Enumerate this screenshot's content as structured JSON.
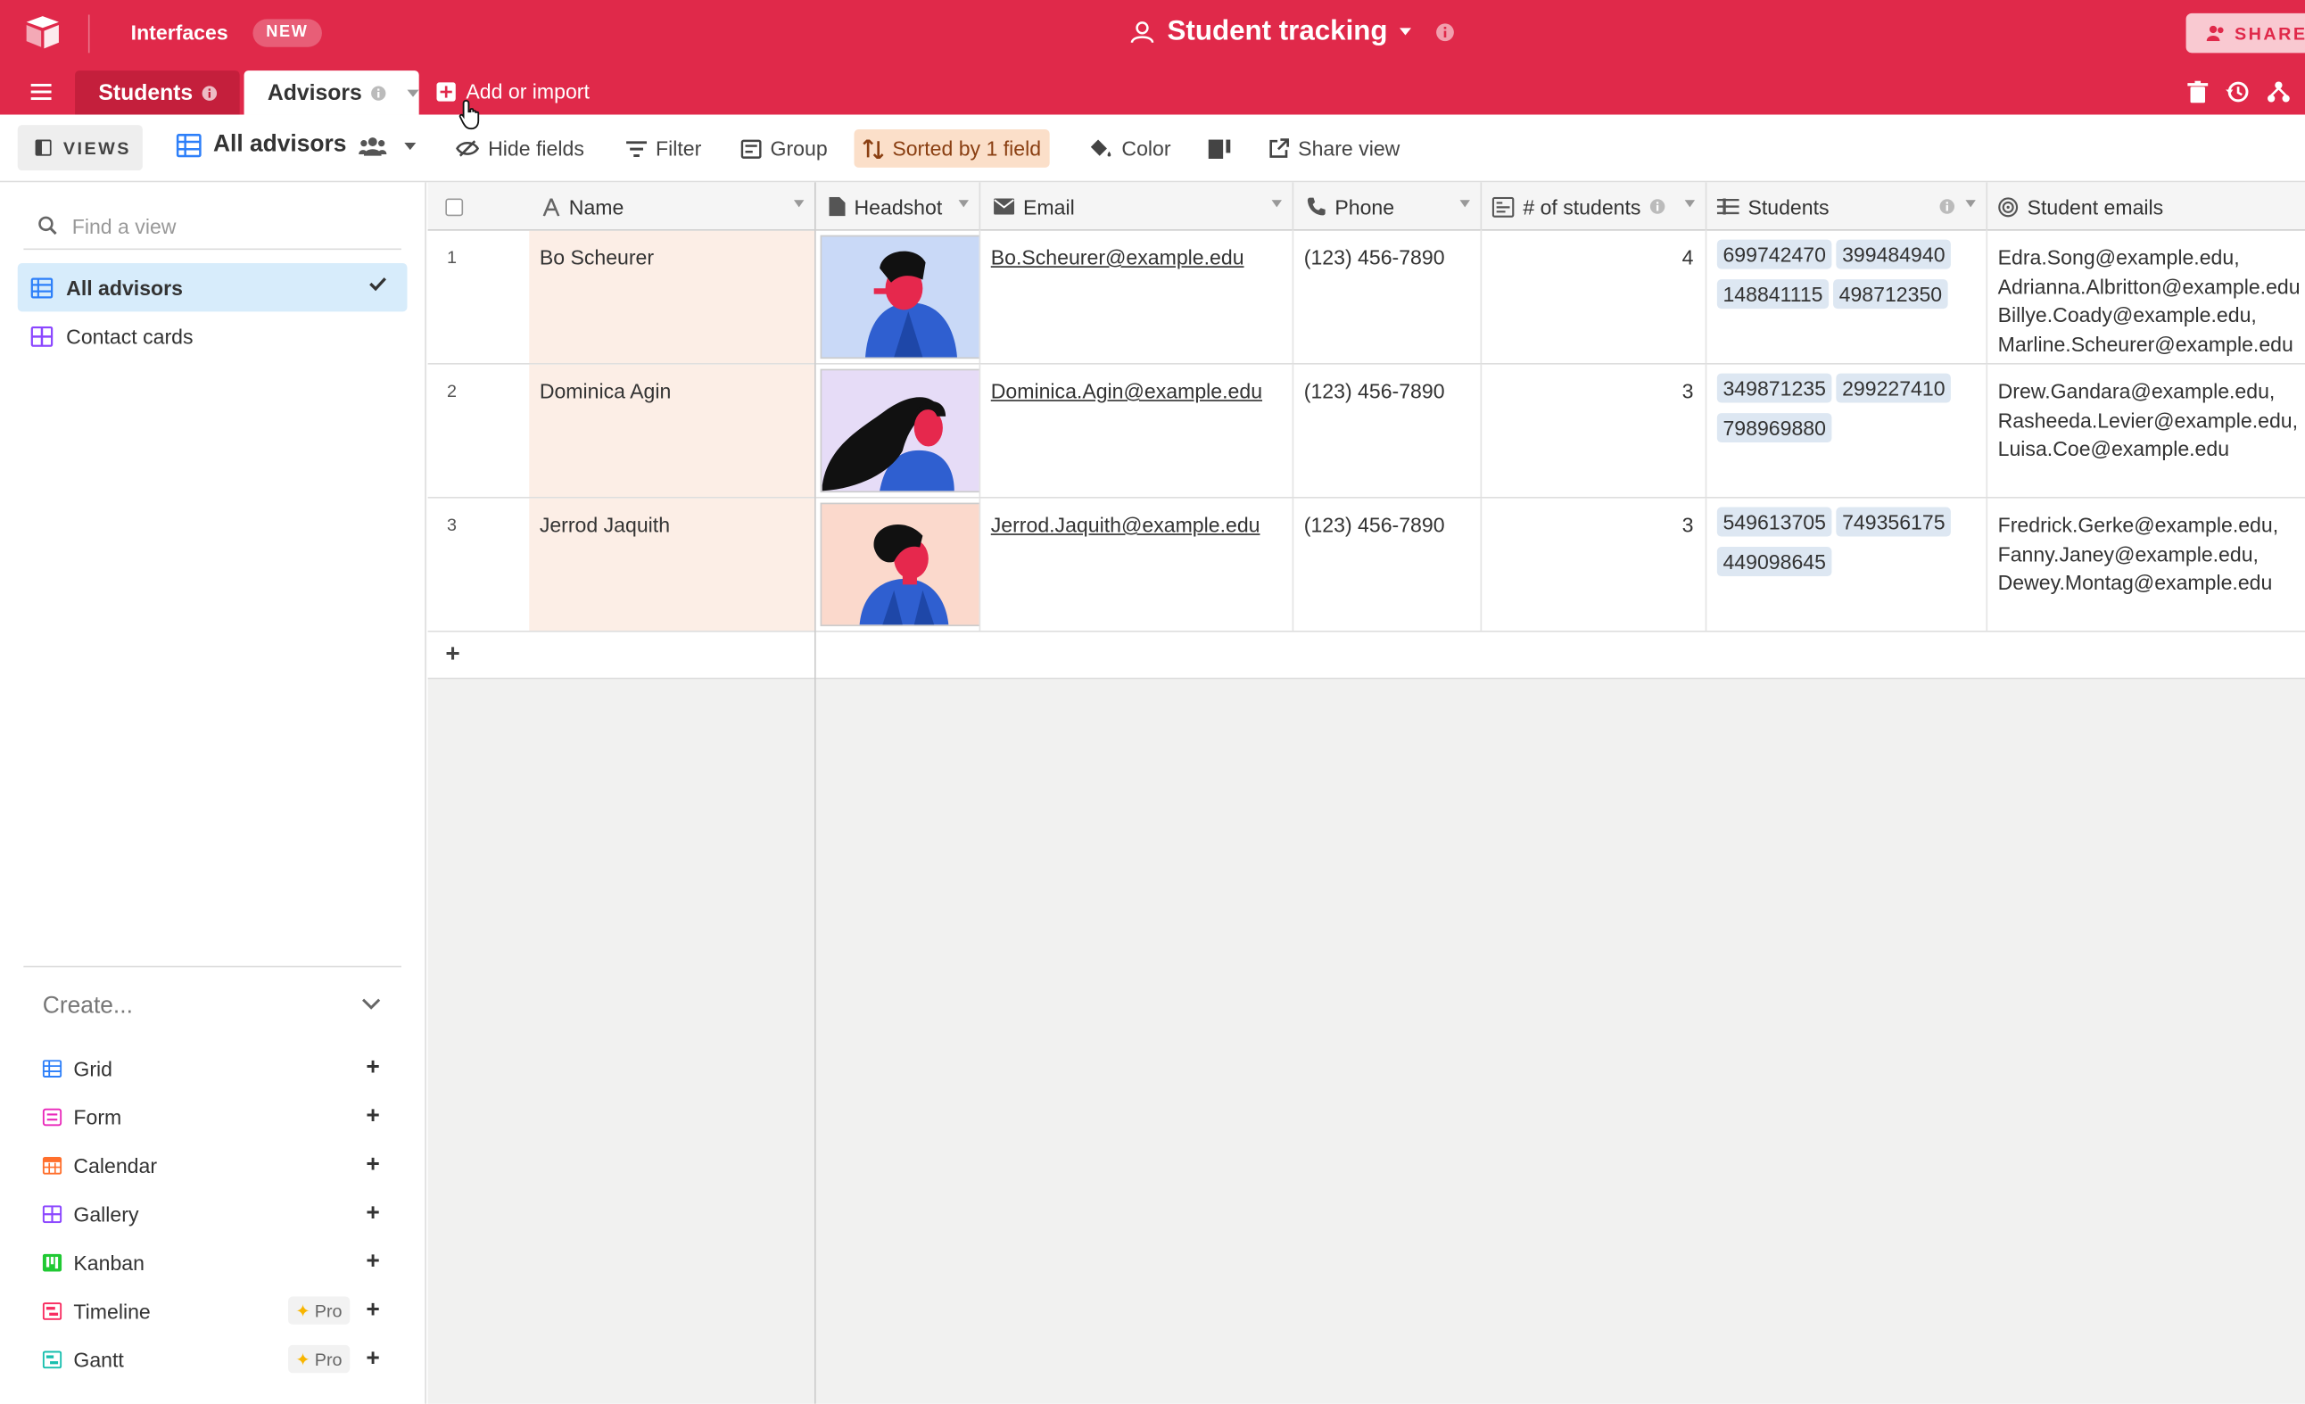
{
  "app": {
    "interfaces_label": "Interfaces",
    "new_badge": "NEW",
    "base_title": "Student tracking",
    "share_label": "SHARE"
  },
  "tabs": [
    {
      "label": "Students",
      "active": false
    },
    {
      "label": "Advisors",
      "active": true
    }
  ],
  "add_import_label": "Add or import",
  "toolbar": {
    "views_label": "VIEWS",
    "view_name": "All advisors",
    "hide_fields": "Hide fields",
    "filter": "Filter",
    "group": "Group",
    "sorted": "Sorted by 1 field",
    "color": "Color",
    "share_view": "Share view"
  },
  "sidebar": {
    "find_placeholder": "Find a view",
    "views": [
      {
        "label": "All advisors",
        "active": true
      },
      {
        "label": "Contact cards",
        "active": false
      }
    ],
    "create_label": "Create...",
    "create_items": [
      {
        "label": "Grid",
        "color": "#2d7ff9"
      },
      {
        "label": "Form",
        "color": "#e929ba"
      },
      {
        "label": "Calendar",
        "color": "#ff6f2c"
      },
      {
        "label": "Gallery",
        "color": "#8b46ff"
      },
      {
        "label": "Kanban",
        "color": "#20c933"
      },
      {
        "label": "Timeline",
        "color": "#f82b60",
        "pro": "Pro"
      },
      {
        "label": "Gantt",
        "color": "#18bfae",
        "pro": "Pro"
      }
    ]
  },
  "columns": {
    "name": "Name",
    "headshot": "Headshot",
    "email": "Email",
    "phone": "Phone",
    "num_students": "# of students",
    "students": "Students",
    "student_emails": "Student emails"
  },
  "rows": [
    {
      "num": "1",
      "name": "Bo Scheurer",
      "email": "Bo.Scheurer@example.edu",
      "phone": "(123) 456-7890",
      "count": "4",
      "students": [
        "699742470",
        "399484940",
        "148841115",
        "498712350"
      ],
      "student_emails": [
        "Edra.Song@example.edu,",
        "Adrianna.Albritton@example.edu",
        "Billye.Coady@example.edu,",
        "Marline.Scheurer@example.edu"
      ]
    },
    {
      "num": "2",
      "name": "Dominica Agin",
      "email": "Dominica.Agin@example.edu",
      "phone": "(123) 456-7890",
      "count": "3",
      "students": [
        "349871235",
        "299227410",
        "798969880"
      ],
      "student_emails": [
        "Drew.Gandara@example.edu,",
        "Rasheeda.Levier@example.edu,",
        "Luisa.Coe@example.edu"
      ]
    },
    {
      "num": "3",
      "name": "Jerrod Jaquith",
      "email": "Jerrod.Jaquith@example.edu",
      "phone": "(123) 456-7890",
      "count": "3",
      "students": [
        "549613705",
        "749356175",
        "449098645"
      ],
      "student_emails": [
        "Fredrick.Gerke@example.edu,",
        "Fanny.Janey@example.edu,",
        "Dewey.Montag@example.edu"
      ]
    }
  ],
  "colors": {
    "brand": "#e0294a",
    "sorted_bg": "#fbdfc9",
    "active_view_bg": "#d7ecfb",
    "chip_bg": "#dde7f2"
  }
}
